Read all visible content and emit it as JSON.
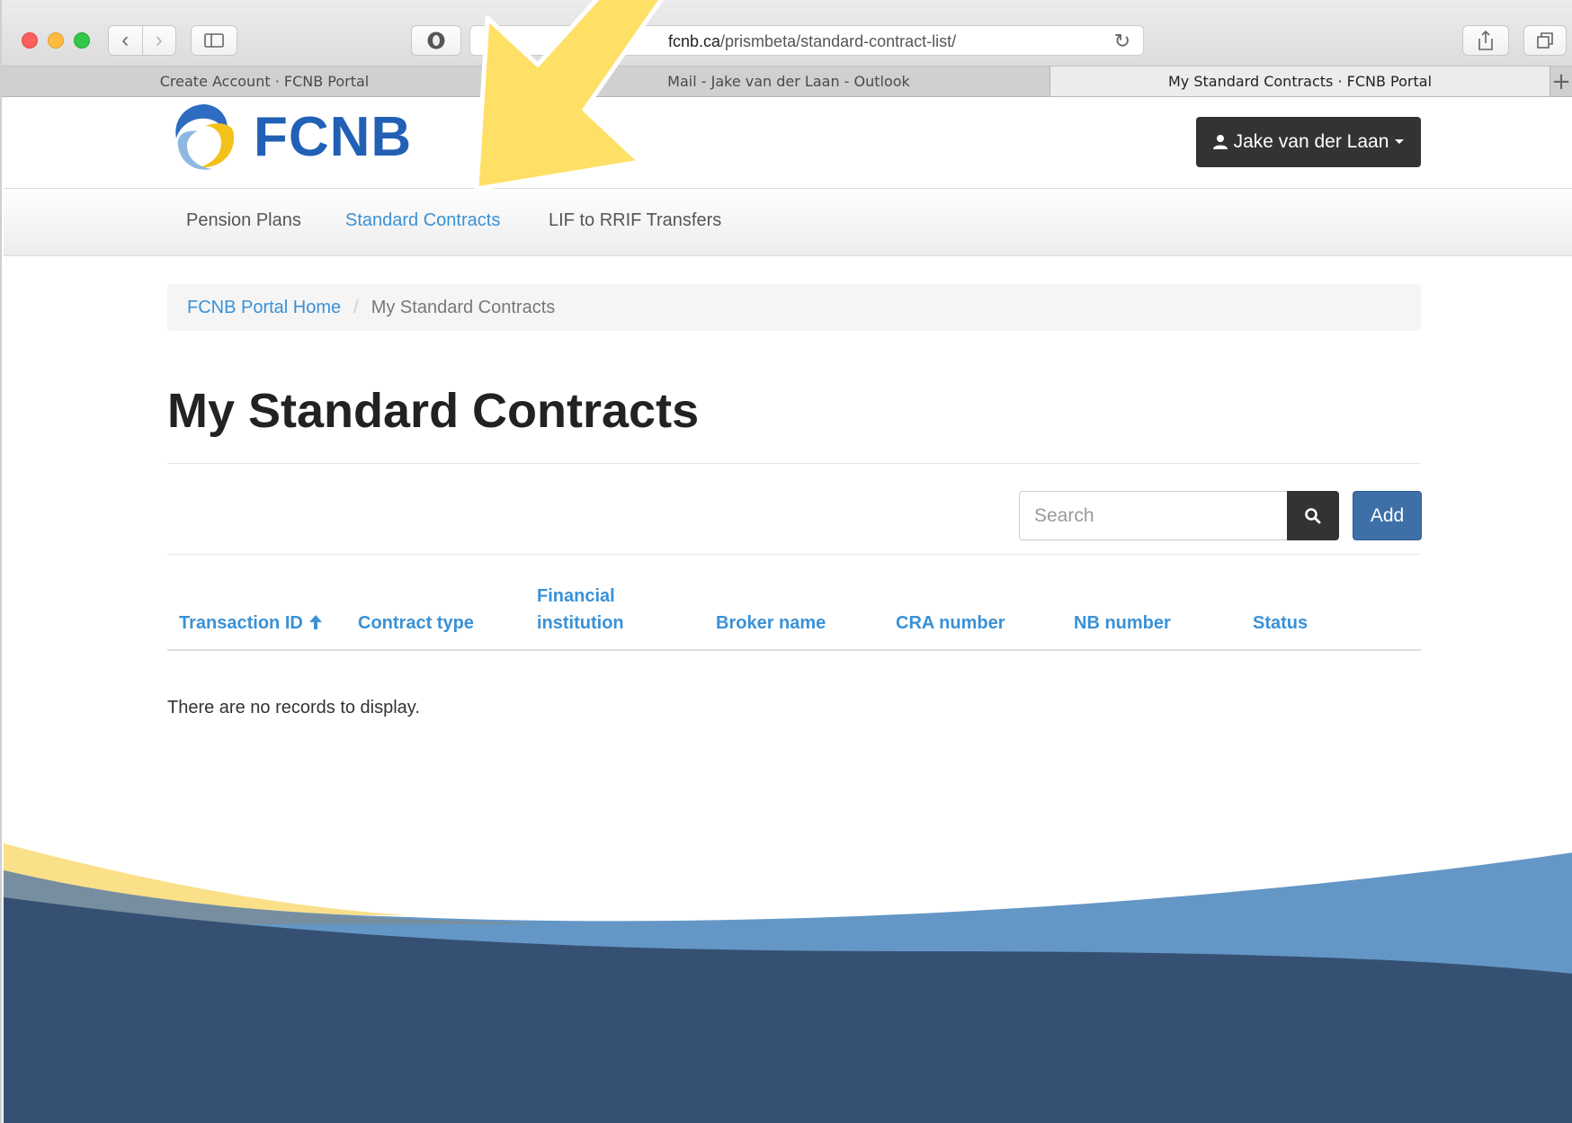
{
  "browser": {
    "url_host": "fcnb.ca",
    "url_path": "/prismbeta/standard-contract-list/",
    "tabs": [
      {
        "label": "Create Account  · FCNB Portal",
        "active": false
      },
      {
        "label": "Mail - Jake van der Laan - Outlook",
        "active": false
      },
      {
        "label": "My Standard Contracts  · FCNB Portal",
        "active": true
      }
    ],
    "new_tab_label": "+"
  },
  "header": {
    "logo_text": "FCNB",
    "user_label": "Jake van der Laan",
    "user_icon": "user-icon",
    "caret_icon": "caret-down-icon"
  },
  "nav": {
    "items": [
      {
        "label": "Pension Plans",
        "active": false
      },
      {
        "label": "Standard Contracts",
        "active": true
      },
      {
        "label": "LIF to RRIF Transfers",
        "active": false
      }
    ]
  },
  "breadcrumb": {
    "home": "FCNB Portal Home",
    "separator": "/",
    "current": "My Standard Contracts"
  },
  "page": {
    "title": "My Standard Contracts",
    "search_placeholder": "Search",
    "add_label": "Add",
    "empty_message": "There are no records to display."
  },
  "table": {
    "columns": [
      {
        "label": "Transaction ID",
        "sorted": "asc"
      },
      {
        "label": "Contract type"
      },
      {
        "label": "Financial institution"
      },
      {
        "label": "Broker name"
      },
      {
        "label": "CRA number"
      },
      {
        "label": "NB number"
      },
      {
        "label": "Status"
      }
    ],
    "rows": []
  },
  "colors": {
    "link": "#3a91d6",
    "brand_blue": "#2160b5",
    "add_button": "#3e6fa7",
    "dark_button": "#333333",
    "footer_navy": "#355073",
    "footer_blue": "#6497c6",
    "footer_yellow": "#fbe08a",
    "arrow_yellow": "#ffe066"
  }
}
